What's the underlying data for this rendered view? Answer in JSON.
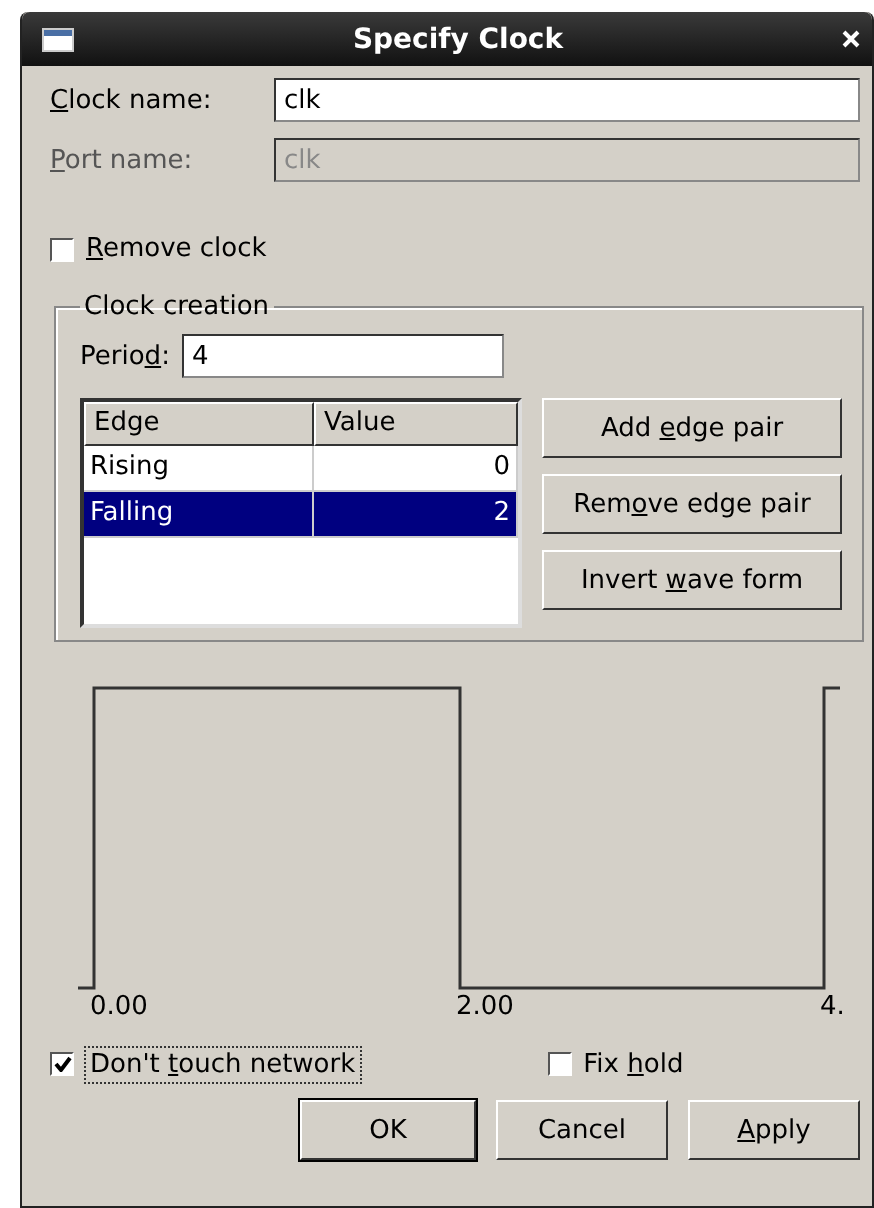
{
  "window": {
    "title": "Specify Clock"
  },
  "clock_name": {
    "label": {
      "key": "C",
      "after": "lock name:"
    },
    "value": "clk",
    "disabled": false
  },
  "port_name": {
    "label": {
      "key": "P",
      "after": "ort name:"
    },
    "value": "clk",
    "disabled": true
  },
  "remove_clock": {
    "label": {
      "key": "R",
      "after": "emove clock"
    },
    "checked": false
  },
  "clock_creation": {
    "title": "Clock creation",
    "period": {
      "label": {
        "before": "Perio",
        "key": "d",
        "after": ":"
      },
      "value": "4"
    },
    "table": {
      "columns": [
        "Edge",
        "Value"
      ],
      "rows": [
        {
          "edge": "Rising",
          "value": "0",
          "selected": false
        },
        {
          "edge": "Falling",
          "value": "2",
          "selected": true
        }
      ]
    },
    "buttons": [
      {
        "before": "Add ",
        "key": "e",
        "after": "dge pair"
      },
      {
        "before": "Rem",
        "key": "o",
        "after": "ve edge pair"
      },
      {
        "before": "Invert ",
        "key": "w",
        "after": "ave form"
      }
    ]
  },
  "waveform": {
    "tick_labels": [
      "0.00",
      "2.00",
      "4."
    ]
  },
  "dont_touch_network": {
    "label": {
      "before": "Don't ",
      "key": "t",
      "after": "ouch network"
    },
    "checked": true
  },
  "fix_hold": {
    "label": {
      "before": "Fix ",
      "key": "h",
      "after": "old"
    },
    "checked": false
  },
  "buttons": [
    {
      "before": "OK",
      "default": true
    },
    {
      "before": "Cancel",
      "default": false
    },
    {
      "key": "A",
      "after": "pply",
      "default": false
    }
  ]
}
